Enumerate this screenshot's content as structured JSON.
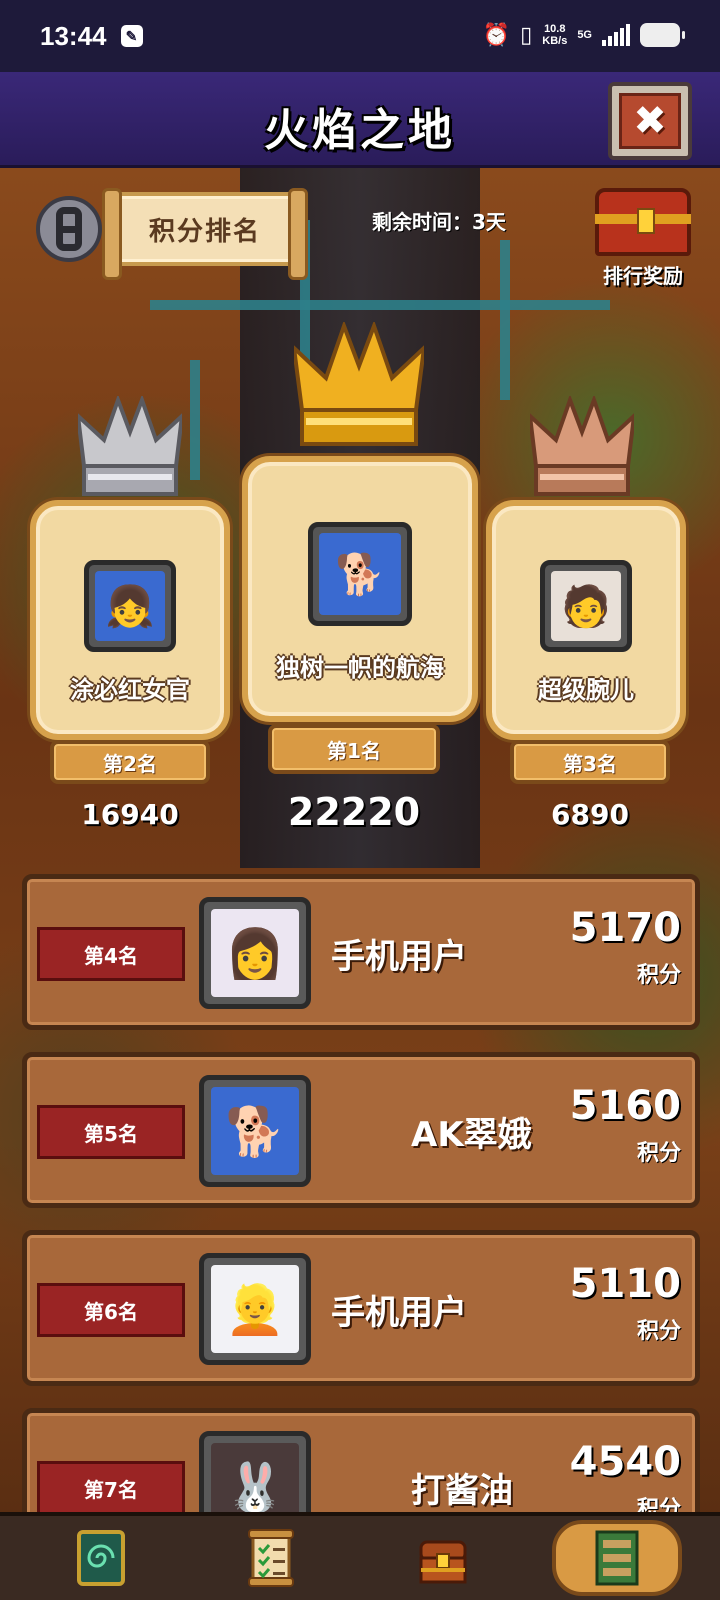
{
  "status_bar": {
    "time": "13:44",
    "net_speed_value": "10.8",
    "net_speed_unit": "KB/s",
    "network_type": "5G"
  },
  "header": {
    "title": "火焰之地",
    "close_symbol": "✖"
  },
  "info_bar": {
    "mode_label": "积分排名",
    "time_left": "剩余时间：3天",
    "reward_label": "排行奖励"
  },
  "podium": [
    {
      "rank_label": "第2名",
      "name": "涂必红女官",
      "score": "16940",
      "crown": "silver",
      "avatar": "anime-girl"
    },
    {
      "rank_label": "第1名",
      "name": "独树一帜的航海",
      "score": "22220",
      "crown": "gold",
      "avatar": "shiba-dog"
    },
    {
      "rank_label": "第3名",
      "name": "超级腕儿",
      "score": "6890",
      "crown": "bronze",
      "avatar": "man-in-suit"
    }
  ],
  "list": [
    {
      "rank_label": "第4名",
      "name": "手机用户",
      "score": "5170",
      "unit": "积分",
      "avatar": "anime-girl-white-hair"
    },
    {
      "rank_label": "第5名",
      "name": "AK翠娥",
      "score": "5160",
      "unit": "积分",
      "avatar": "shiba-dog"
    },
    {
      "rank_label": "第6名",
      "name": "手机用户",
      "score": "5110",
      "unit": "积分",
      "avatar": "anime-girl-goggles"
    },
    {
      "rank_label": "第7名",
      "name": "打酱油",
      "score": "4540",
      "unit": "积分",
      "avatar": "anime-girl-bunny"
    }
  ],
  "bottom_nav": [
    {
      "icon": "spiral-card-icon"
    },
    {
      "icon": "quest-scroll-icon"
    },
    {
      "icon": "treasure-chest-icon"
    },
    {
      "icon": "ranking-board-icon",
      "active": true
    }
  ],
  "colors": {
    "header": "#3a2878",
    "card": "#f2d9a2",
    "row": "#a8683a",
    "rank_tag": "#9a2424",
    "gold": "#f0b020",
    "silver": "#c8c8cc",
    "bronze": "#d89a7a"
  }
}
